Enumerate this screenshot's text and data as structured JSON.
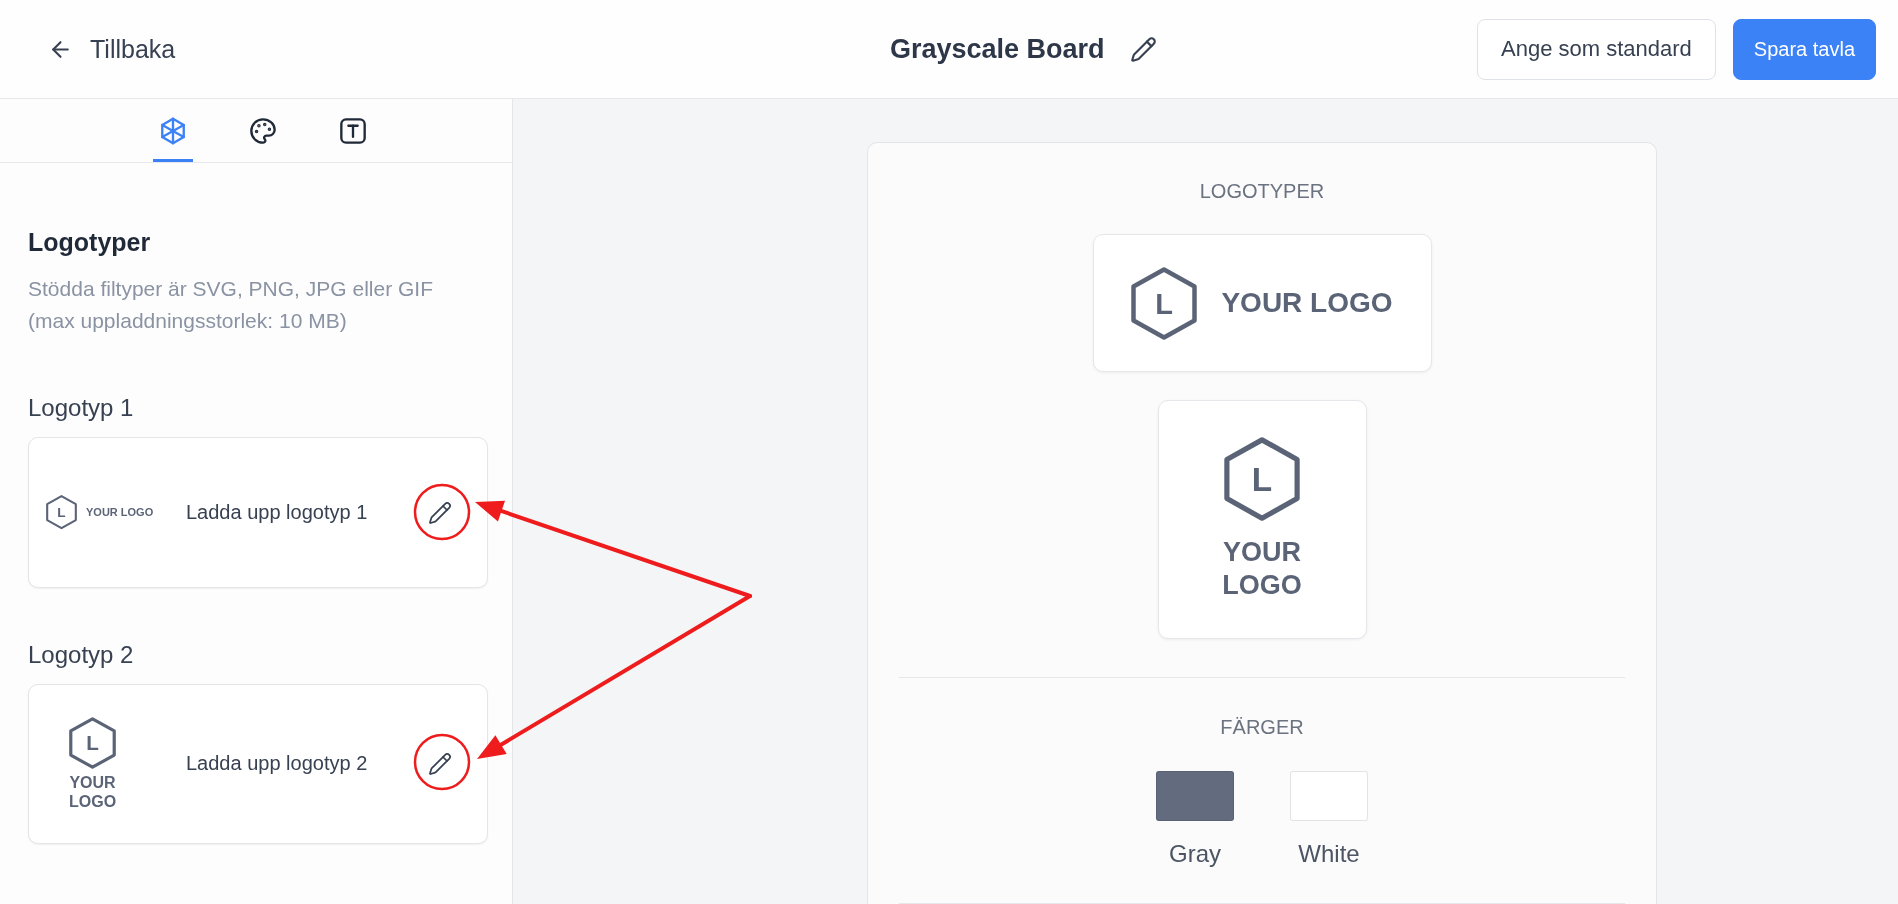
{
  "header": {
    "back_label": "Tillbaka",
    "title": "Grayscale Board",
    "buttons": [
      {
        "label": "Ange som standard",
        "kind": "secondary"
      },
      {
        "label": "Spara tavla",
        "kind": "primary"
      }
    ]
  },
  "sidebar": {
    "tabs": [
      {
        "kind": "logos",
        "selected": true
      },
      {
        "kind": "colors",
        "selected": false
      },
      {
        "kind": "fonts",
        "selected": false
      }
    ],
    "heading": "Logotyper",
    "description": "Stödda filtyper är SVG, PNG, JPG eller GIF (max uppladdningsstorlek: 10 MB)",
    "logo_slots": [
      {
        "label": "Logotyp 1",
        "logo": {
          "kind": "horizontal",
          "mark": "L",
          "text": "YOUR LOGO"
        },
        "upload_label": "Ladda upp logotyp 1",
        "highlighted": true
      },
      {
        "label": "Logotyp 2",
        "logo": {
          "kind": "stacked",
          "mark": "L",
          "text": "YOUR LOGO"
        },
        "upload_label": "Ladda upp logotyp 2",
        "highlighted": true
      }
    ]
  },
  "preview": {
    "sections": [
      {
        "kind": "logos",
        "title": "LOGOTYPER",
        "logos": [
          {
            "kind": "horizontal",
            "mark": "L",
            "text": "YOUR LOGO"
          },
          {
            "kind": "stacked",
            "mark": "L",
            "text": "YOUR LOGO"
          }
        ]
      },
      {
        "kind": "colors",
        "title": "FÄRGER",
        "colors": [
          {
            "name": "Gray",
            "color": "#636b7f"
          },
          {
            "name": "White",
            "color": "#ffffff"
          }
        ]
      }
    ]
  }
}
